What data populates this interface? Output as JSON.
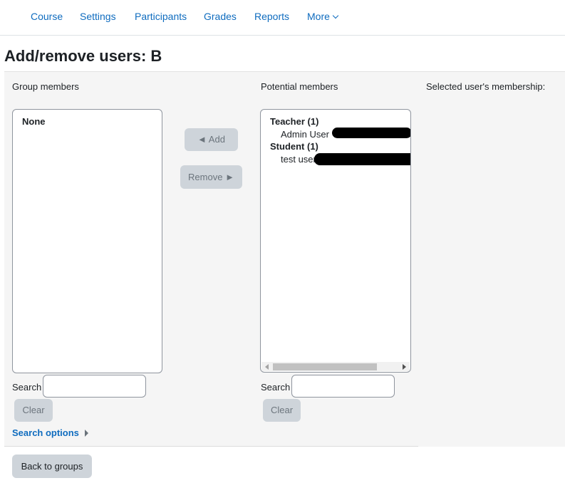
{
  "nav": {
    "items": [
      {
        "label": "Course"
      },
      {
        "label": "Settings"
      },
      {
        "label": "Participants"
      },
      {
        "label": "Grades"
      },
      {
        "label": "Reports"
      },
      {
        "label": "More"
      }
    ]
  },
  "page_title": "Add/remove users: B",
  "group_members": {
    "label": "Group members",
    "options": [
      "None"
    ],
    "search_label": "Search",
    "search_value": "",
    "clear_label": "Clear"
  },
  "actions": {
    "add_label": "◄ Add",
    "remove_label": "Remove ►"
  },
  "potential_members": {
    "label": "Potential members",
    "groups": [
      {
        "heading": "Teacher (1)",
        "users": [
          "Admin User"
        ]
      },
      {
        "heading": "Student (1)",
        "users": [
          "test user"
        ]
      }
    ],
    "search_label": "Search",
    "search_value": "",
    "clear_label": "Clear"
  },
  "selected_membership_label": "Selected user's membership:",
  "search_options_label": "Search options",
  "back_button_label": "Back to groups",
  "colors": {
    "link": "#0f6cbf",
    "button_bg": "#ced4da",
    "panel_bg": "#f5f5f5"
  },
  "icons": [
    "chevron-down-icon",
    "caret-right-icon",
    "scroll-left-icon",
    "scroll-right-icon"
  ]
}
